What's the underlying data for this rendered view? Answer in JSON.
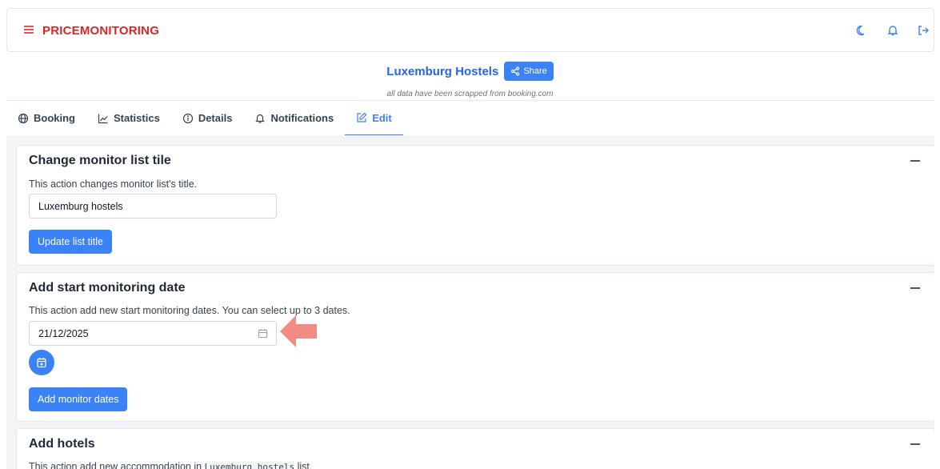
{
  "header": {
    "brand": "PRICEMONITORING",
    "icons": [
      "menu-icon",
      "moon-icon",
      "bell-icon",
      "logout-icon"
    ]
  },
  "page": {
    "title": "Luxemburg Hostels",
    "share_label": "Share",
    "subtitle": "all data have been scrapped from booking.com"
  },
  "tabs": [
    {
      "label": "Booking",
      "icon": "globe-icon"
    },
    {
      "label": "Statistics",
      "icon": "chart-icon"
    },
    {
      "label": "Details",
      "icon": "info-icon"
    },
    {
      "label": "Notifications",
      "icon": "bell-icon"
    },
    {
      "label": "Edit",
      "icon": "edit-icon",
      "active": true
    }
  ],
  "cards": {
    "title_card": {
      "title": "Change monitor list tile",
      "description": "This action changes monitor list's title.",
      "input_value": "Luxemburg hostels",
      "button": "Update list title"
    },
    "dates_card": {
      "title": "Add start monitoring date",
      "description": "This action add new start monitoring dates. You can select up to 3 dates.",
      "date_value": "21/12/2025",
      "button": "Add monitor dates"
    },
    "hotels_card": {
      "title": "Add hotels",
      "description_prefix": "This action add new accommodation in ",
      "description_code": "Luxemburg hostels",
      "description_suffix": " list."
    }
  },
  "colors": {
    "brand": "#dc2626",
    "accent": "#3b82f6",
    "arrow": "#f28b82"
  }
}
